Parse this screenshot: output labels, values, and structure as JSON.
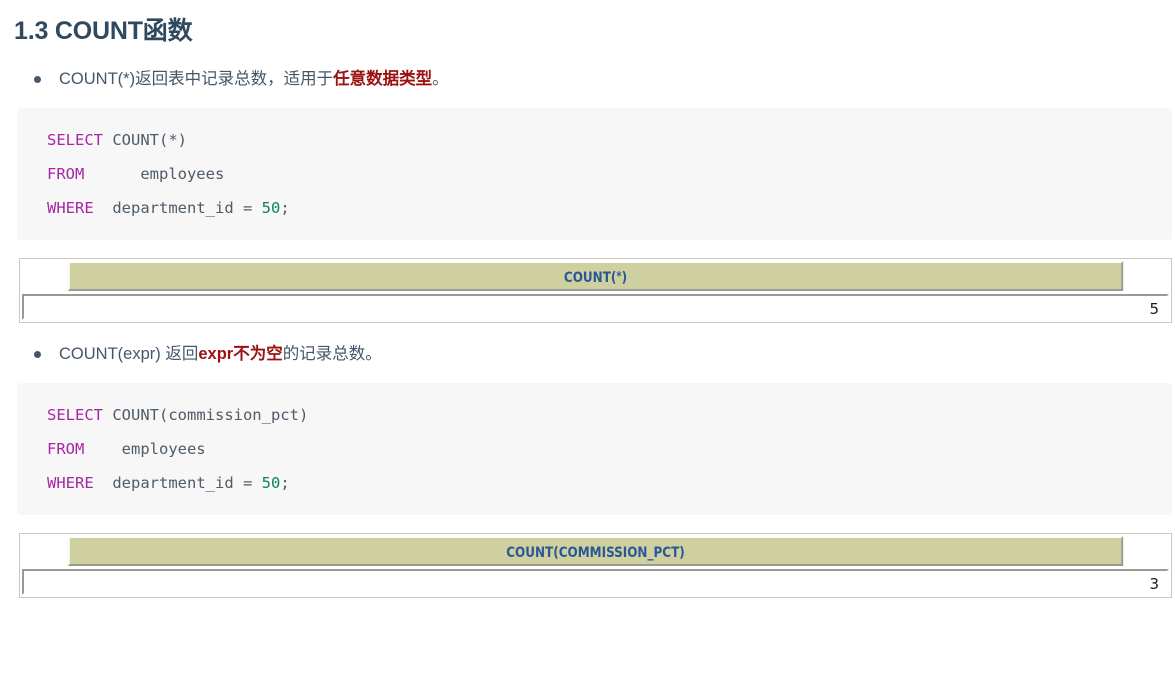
{
  "heading": "1.3 COUNT函数",
  "sections": [
    {
      "bullet": {
        "pre": "COUNT(*)返回表中记录总数，适用于",
        "emphasis": "任意数据类型",
        "post": "。"
      },
      "code": {
        "line1_kw": "SELECT",
        "line1_rest": " COUNT(*)",
        "line2_kw": "FROM",
        "line2_rest": "      employees",
        "line3_kw": "WHERE",
        "line3_rest": "  department_id = ",
        "line3_num": "50",
        "line3_end": ";",
        "full": "SELECT COUNT(*)\nFROM      employees\nWHERE  department_id = 50;"
      },
      "result": {
        "header_text": "COUNT(*)",
        "header_label": "COUNT(",
        "header_star": "*",
        "header_close": ")",
        "value": "5"
      }
    },
    {
      "bullet": {
        "pre": "COUNT(expr) 返回",
        "emphasis": "expr不为空",
        "post": "的记录总数。"
      },
      "code": {
        "line1_kw": "SELECT",
        "line1_rest": " COUNT(commission_pct)",
        "line2_kw": "FROM",
        "line2_rest": "    employees",
        "line3_kw": "WHERE",
        "line3_rest": "  department_id = ",
        "line3_num": "50",
        "line3_end": ";",
        "full": "SELECT COUNT(commission_pct)\nFROM    employees\nWHERE  department_id = 50;"
      },
      "result": {
        "header_text": "COUNT(COMMISSION_PCT)",
        "header_label": "COUNT(COMMISSION_PCT)",
        "header_star": "",
        "header_close": "",
        "value": "3"
      }
    }
  ],
  "colors": {
    "heading": "#31495f",
    "body_text": "#46566a",
    "emphasis": "#9c1111",
    "keyword": "#a626a4",
    "number": "#098658",
    "identifier": "#4f5b66",
    "code_bg": "#f7f7f8",
    "table_header_bg": "#ced0a0",
    "table_header_text": "#2b5797"
  }
}
